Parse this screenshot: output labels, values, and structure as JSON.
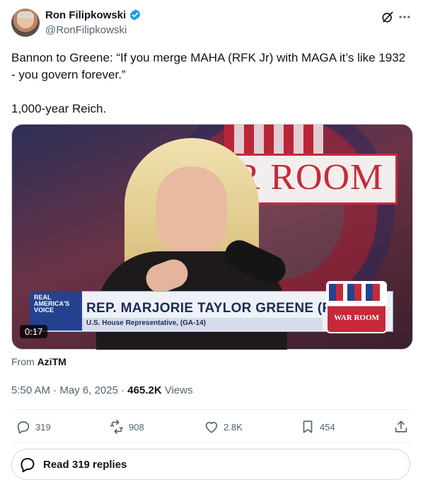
{
  "author": {
    "display_name": "Ron Filipkowski",
    "handle": "@RonFilipkowski",
    "verified": true
  },
  "tweet": {
    "text": "Bannon to Greene: “If you merge MAHA (RFK Jr) with MAGA it’s like 1932 - you govern forever.”\n\n1,000-year Reich."
  },
  "media": {
    "background_sign": "WAR ROOM",
    "lower_third": {
      "brand": "REAL\nAMERICA'S\nVOICE",
      "name": "REP. MARJORIE TAYLOR GREENE (R)",
      "subtitle": "U.S. House Representative, (GA-14)",
      "logo_text": "WAR ROOM"
    },
    "duration": "0:17"
  },
  "source": {
    "prefix": "From",
    "name": "AziTM"
  },
  "meta": {
    "time": "5:50 AM",
    "separator": "·",
    "date": "May 6, 2025",
    "views_count": "465.2K",
    "views_label": "Views"
  },
  "actions": {
    "replies": "319",
    "reposts": "908",
    "likes": "2.8K",
    "bookmarks": "454"
  },
  "read_replies_label": "Read 319 replies",
  "colors": {
    "verified": "#1d9bf0",
    "text_primary": "#0f1419",
    "text_secondary": "#536471",
    "border": "#cfd9de"
  },
  "icons": [
    "verified-badge-icon",
    "grok-icon",
    "more-icon",
    "reply-icon",
    "repost-icon",
    "like-icon",
    "bookmark-icon",
    "share-icon",
    "speech-bubble-icon"
  ]
}
